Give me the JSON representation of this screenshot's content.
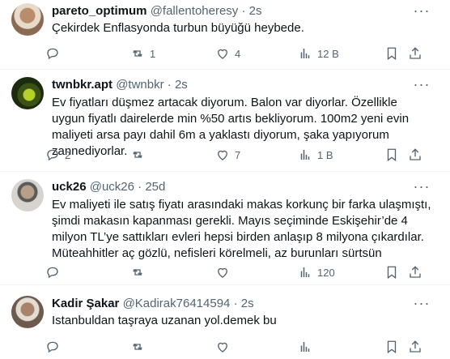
{
  "posts": [
    {
      "name": "pareto_optimum",
      "handle": "@fallentoheresy",
      "dot": "·",
      "time": "2s",
      "more": "···",
      "text": "Çekirdek Enflasyonda turbun büyüğü heybede.",
      "replies": "",
      "reposts": "1",
      "likes": "4",
      "views": "12 B",
      "avatar_colors": [
        "#c9b49a",
        "#8a6a52"
      ]
    },
    {
      "name": "twnbkr.apt",
      "handle": "@twnbkr",
      "dot": "·",
      "time": "2s",
      "more": "···",
      "text": "Ev fiyatları düşmez artacak diyorum. Balon var diyorlar. Özellikle uygun fiyatlı dairelerde min %50 artıs bekliyorum. 100m2 yeni evin maliyeti arsa payı dahil 6m a yaklastı diyorum, şaka yapıyorum zannediyorlar.",
      "replies": "2",
      "reposts": "",
      "likes": "7",
      "views": "1 B",
      "avatar_colors": [
        "#1c2a10",
        "#9bbf2a"
      ]
    },
    {
      "name": "uck26",
      "handle": "@uck26",
      "dot": "·",
      "time": "25d",
      "more": "···",
      "text": "Ev maliyeti ile satış fiyatı arasındaki makas korkunç bir farka ulaşmıştı, şimdi makasın kapanması gerekli. Mayıs seçiminde Eskişehir’de 4 milyon TL’ye sattıkları evleri hepsi birden anlaşıp 8 milyona çıkardılar. Müteahhitler aç gözlü, nefisleri körelmeli, az burunları sürtsün",
      "replies": "",
      "reposts": "",
      "likes": "",
      "views": "120",
      "avatar_colors": [
        "#d7d4cf",
        "#4a4a4a"
      ]
    },
    {
      "name": "Kadir Şakar",
      "handle": "@Kadirak76414594",
      "dot": "·",
      "time": "2s",
      "more": "···",
      "text": "Istanbuldan taşraya uzanan yol.demek bu",
      "replies": "",
      "reposts": "",
      "likes": "",
      "views": "",
      "avatar_colors": [
        "#cfc6bb",
        "#6e5b4d"
      ]
    }
  ],
  "icons": [
    "reply-icon",
    "repost-icon",
    "like-icon",
    "views-icon",
    "bookmark-icon",
    "share-icon"
  ],
  "colors": {
    "text": "#0f1419",
    "secondary": "#536471",
    "divider": "#eff3f4"
  }
}
